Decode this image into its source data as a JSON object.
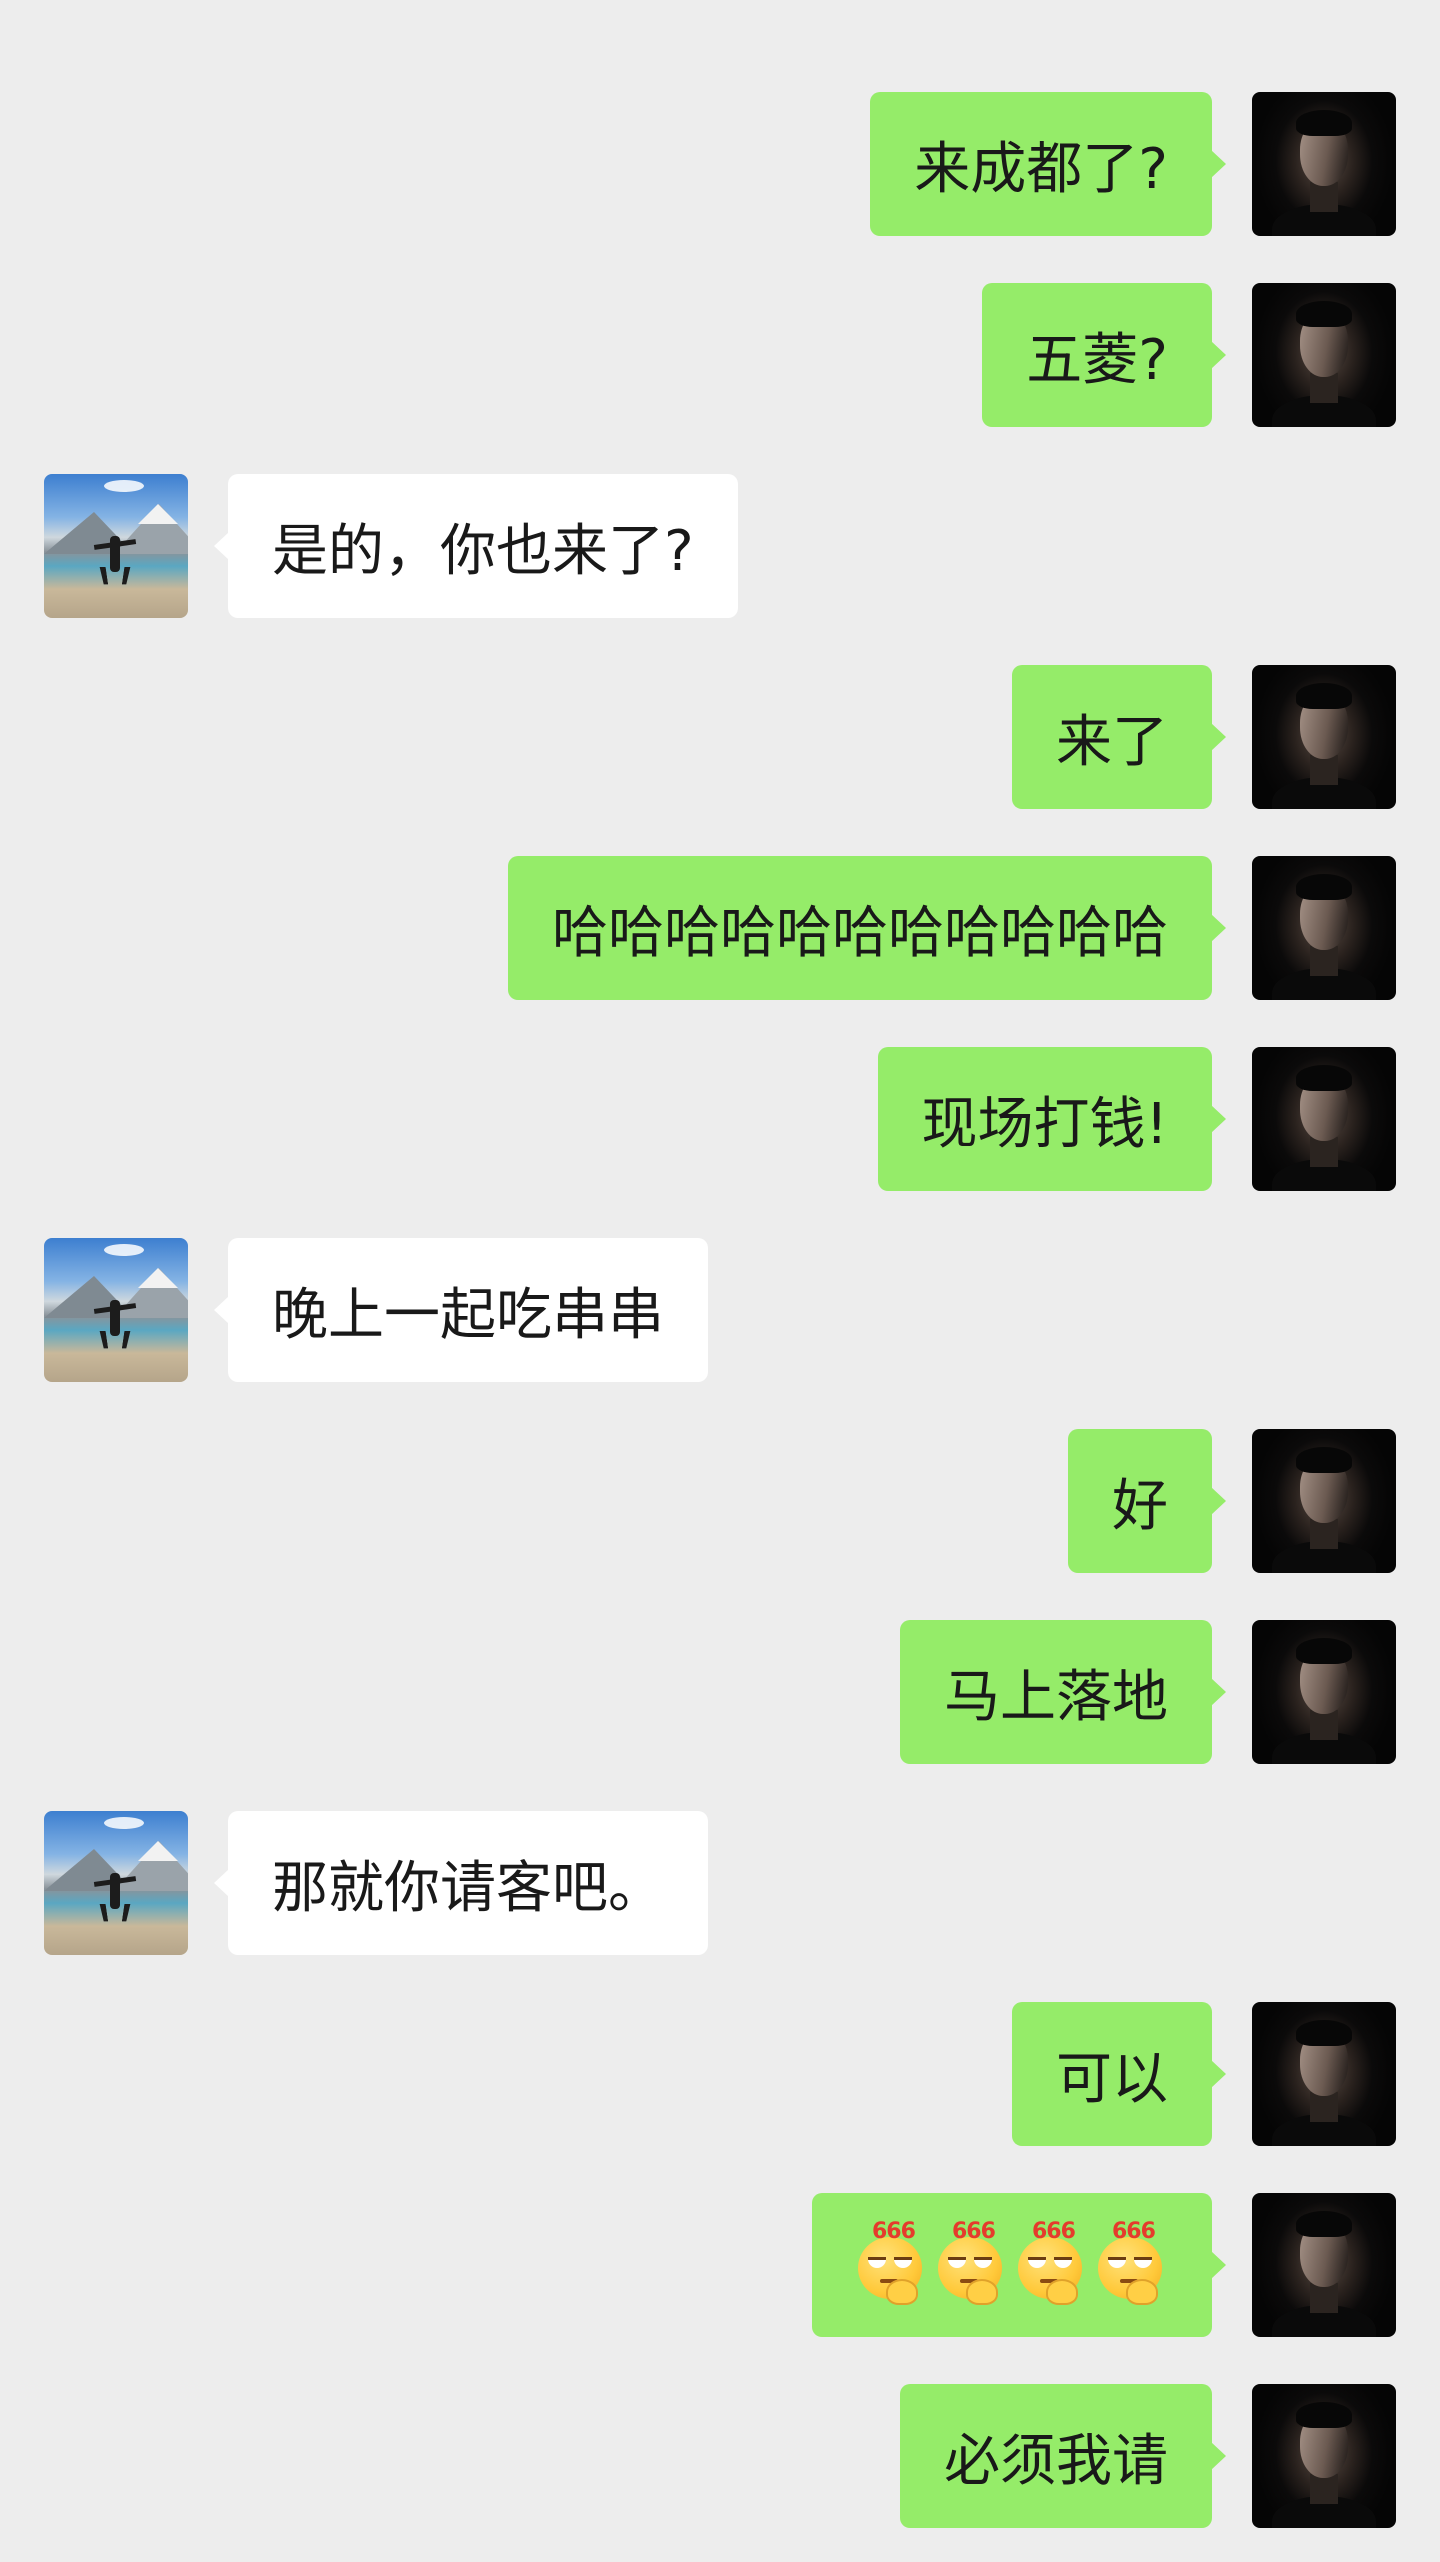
{
  "messages": [
    {
      "sender": "me",
      "text": "来成都了?"
    },
    {
      "sender": "me",
      "text": "五菱?"
    },
    {
      "sender": "them",
      "text": "是的，你也来了?"
    },
    {
      "sender": "me",
      "text": "来了"
    },
    {
      "sender": "me",
      "text": "哈哈哈哈哈哈哈哈哈哈哈"
    },
    {
      "sender": "me",
      "text": "现场打钱!"
    },
    {
      "sender": "them",
      "text": "晚上一起吃串串"
    },
    {
      "sender": "me",
      "text": "好"
    },
    {
      "sender": "me",
      "text": "马上落地"
    },
    {
      "sender": "them",
      "text": "那就你请客吧。"
    },
    {
      "sender": "me",
      "text": "可以"
    },
    {
      "sender": "me",
      "sticker": "666-emoji",
      "sticker_text": "666",
      "count": 4
    },
    {
      "sender": "me",
      "text": "必须我请"
    }
  ],
  "colors": {
    "background": "#ededed",
    "my_bubble": "#95ec69",
    "their_bubble": "#ffffff",
    "text": "#191919"
  }
}
